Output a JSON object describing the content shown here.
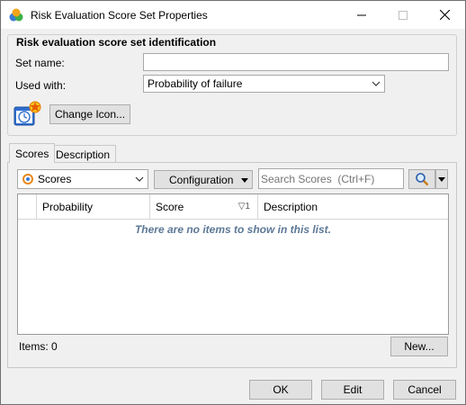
{
  "window": {
    "title": "Risk Evaluation Score Set Properties"
  },
  "identification": {
    "group_title": "Risk evaluation score set identification",
    "set_name_label": "Set name:",
    "set_name_value": "",
    "used_with_label": "Used with:",
    "used_with_value": "Probability of failure",
    "change_icon_label": "Change Icon..."
  },
  "tabs": [
    {
      "label": "Scores",
      "active": true
    },
    {
      "label": "Description",
      "active": false
    }
  ],
  "toolbar": {
    "view_select_value": "Scores",
    "configuration_label": "Configuration",
    "search_placeholder": "Search Scores  (Ctrl+F)"
  },
  "grid": {
    "columns": [
      {
        "label": "Probability"
      },
      {
        "label": "Score",
        "sort_indicator": "▽1"
      },
      {
        "label": "Description"
      }
    ],
    "empty_message": "There are no items to show in this list."
  },
  "status": {
    "items_label": "Items: 0"
  },
  "buttons": {
    "new_label": "New...",
    "ok_label": "OK",
    "edit_label": "Edit",
    "cancel_label": "Cancel"
  }
}
